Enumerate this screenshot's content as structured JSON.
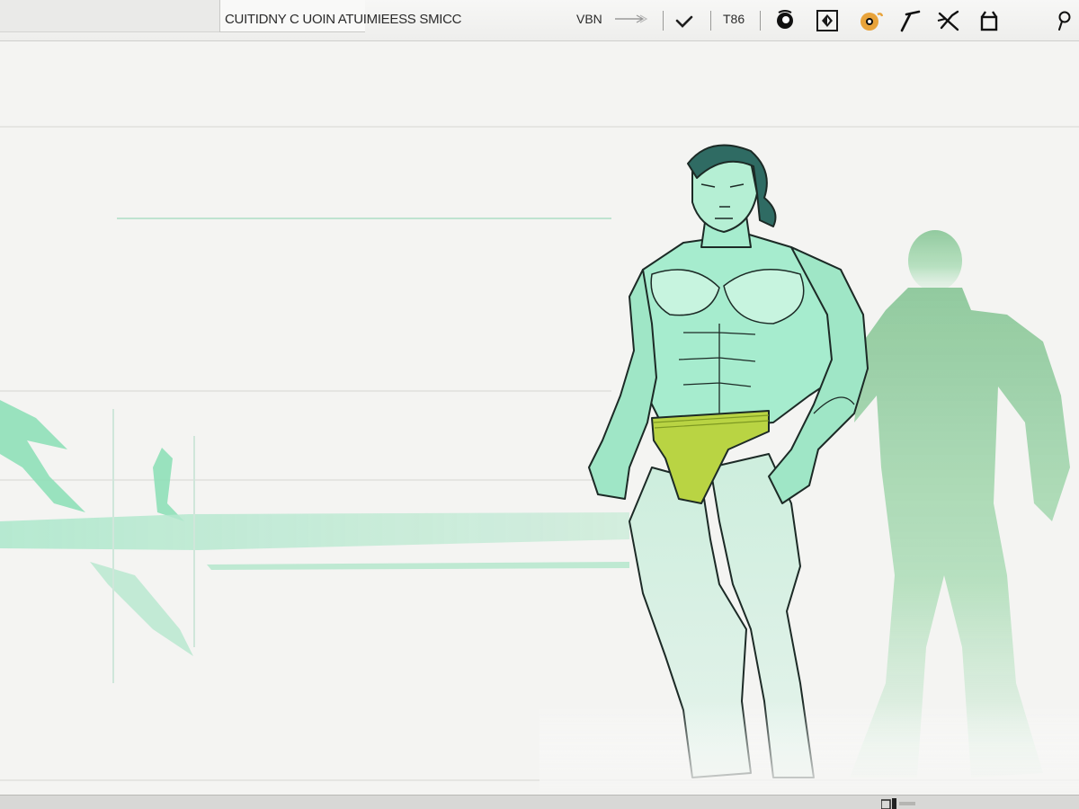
{
  "window": {
    "title": "CUITIDNY C UOIN ATUIMIEESS SMICC"
  },
  "toolbar": {
    "mode_label": "VBN",
    "zoom_value": "T86",
    "tools": [
      {
        "name": "brush-tool",
        "icon": "brush-check-icon"
      },
      {
        "name": "stamp-tool",
        "icon": "stamp-icon"
      },
      {
        "name": "transform-tool",
        "icon": "diamond-arrow-icon"
      },
      {
        "name": "color-picker",
        "icon": "color-circle-icon",
        "color": "#e8a33a"
      },
      {
        "name": "pen-tool",
        "icon": "pen-icon"
      },
      {
        "name": "cut-tool",
        "icon": "scissors-icon"
      },
      {
        "name": "crop-tool",
        "icon": "crop-icon"
      },
      {
        "name": "search-tool",
        "icon": "search-icon"
      }
    ]
  },
  "canvas": {
    "figure": "muscular-character-illustration",
    "shadow": "character-silhouette",
    "colors": {
      "skin": "#9fe6c6",
      "skin_shade": "#6fcf9f",
      "hair": "#2f6b63",
      "briefs": "#b9d443",
      "silhouette": "#8cc79a",
      "stroke_accent": "#7fdcaa"
    }
  }
}
